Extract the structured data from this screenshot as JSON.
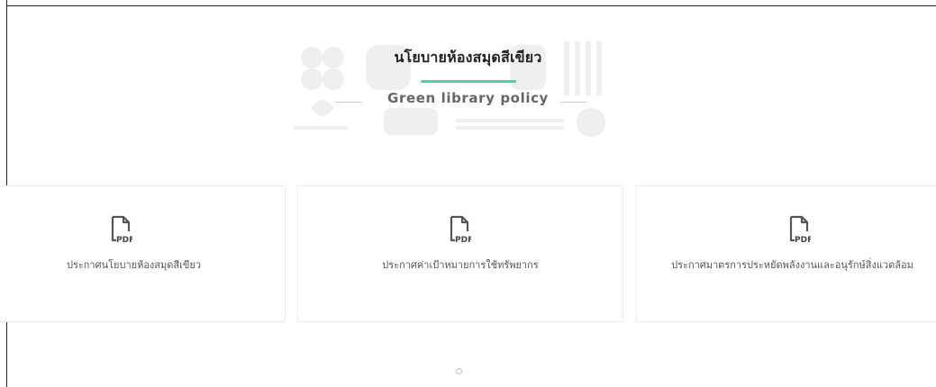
{
  "section": {
    "title": "นโยบายห้องสมุดสีเขียว",
    "subtitle": "Green library policy"
  },
  "colors": {
    "accent": "#5cc9a7",
    "card_border": "#ececec",
    "text": "#555555"
  },
  "documents": [
    {
      "icon": "pdf-file-icon",
      "icon_text": "PDF",
      "label": "ประกาศนโยบายห้องสมุดสีเขียว"
    },
    {
      "icon": "pdf-file-icon",
      "icon_text": "PDF",
      "label": "ประกาศค่าเป้าหมายการใช้ทรัพยากร"
    },
    {
      "icon": "pdf-file-icon",
      "icon_text": "PDF",
      "label": "ประกาศมาตรการประหยัดพลังงานและอนุรักษ์สิ่งแวดล้อม"
    }
  ]
}
